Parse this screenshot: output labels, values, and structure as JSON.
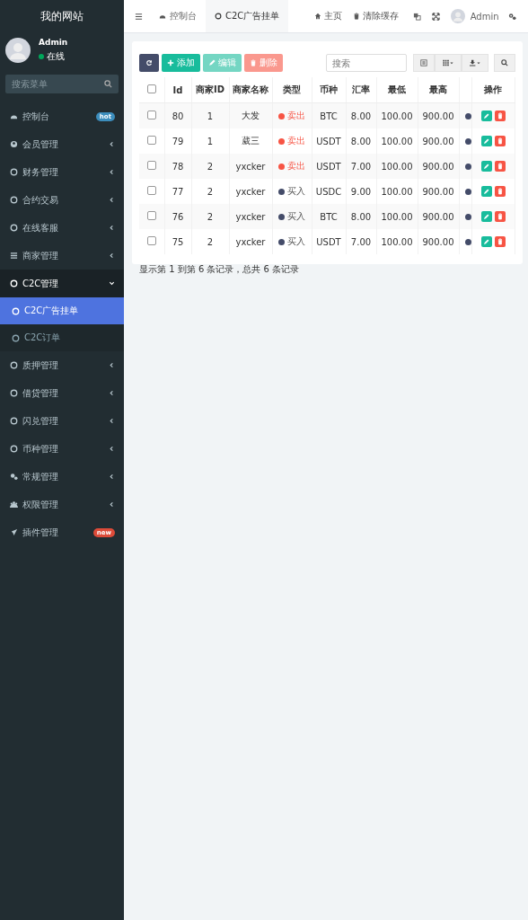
{
  "sidebar": {
    "site_title": "我的网站",
    "user": {
      "name": "Admin",
      "status": "在线"
    },
    "search": {
      "placeholder": "搜索菜单"
    },
    "items": [
      {
        "label": "控制台",
        "badge": {
          "text": "hot",
          "color": "#3c8dbc"
        },
        "expanded": false
      },
      {
        "label": "会员管理",
        "expanded": false
      },
      {
        "label": "财务管理",
        "expanded": false
      },
      {
        "label": "合约交易",
        "expanded": false
      },
      {
        "label": "在线客服",
        "expanded": false
      },
      {
        "label": "商家管理",
        "expanded": false
      },
      {
        "label": "C2C管理",
        "expanded": true,
        "children": [
          {
            "label": "C2C广告挂单",
            "selected": true
          },
          {
            "label": "C2C订单",
            "selected": false
          }
        ]
      },
      {
        "label": "质押管理",
        "expanded": false
      },
      {
        "label": "借贷管理",
        "expanded": false
      },
      {
        "label": "闪兑管理",
        "expanded": false
      },
      {
        "label": "币种管理",
        "expanded": false
      },
      {
        "label": "常规管理",
        "expanded": false
      },
      {
        "label": "权限管理",
        "expanded": false
      },
      {
        "label": "插件管理",
        "badge": {
          "text": "new",
          "color": "#dd4b39"
        },
        "expanded": false
      }
    ]
  },
  "topbar": {
    "tabs": [
      {
        "label": "控制台",
        "selected": false
      },
      {
        "label": "C2C广告挂单",
        "selected": true
      }
    ],
    "links": [
      "主页",
      "清除缓存"
    ],
    "user": "Admin"
  },
  "toolbar": {
    "buttons": [
      {
        "kind": "refresh",
        "disabled": false
      },
      {
        "kind": "add",
        "label": "添加",
        "disabled": false
      },
      {
        "kind": "edit",
        "label": "编辑",
        "disabled": true
      },
      {
        "kind": "delete",
        "label": "删除",
        "disabled": true
      }
    ],
    "search": {
      "placeholder": "搜索"
    }
  },
  "table": {
    "select_all_checked": false,
    "columns": [
      "Id",
      "商家ID",
      "商家名称",
      "类型",
      "币种",
      "汇率",
      "最低",
      "最高",
      "操作"
    ],
    "rows": [
      {
        "checked": false,
        "id": "80",
        "merchant_id": "1",
        "merchant_name": "大发",
        "type": {
          "label": "卖出",
          "color": "#f75444"
        },
        "coin": "BTC",
        "rate": "8.00",
        "min": "100.00",
        "max": "900.00"
      },
      {
        "checked": false,
        "id": "79",
        "merchant_id": "1",
        "merchant_name": "葳三",
        "type": {
          "label": "卖出",
          "color": "#f75444"
        },
        "coin": "USDT",
        "rate": "8.00",
        "min": "100.00",
        "max": "900.00"
      },
      {
        "checked": false,
        "id": "78",
        "merchant_id": "2",
        "merchant_name": "yxcker",
        "type": {
          "label": "卖出",
          "color": "#f75444"
        },
        "coin": "USDT",
        "rate": "7.00",
        "min": "100.00",
        "max": "900.00"
      },
      {
        "checked": false,
        "id": "77",
        "merchant_id": "2",
        "merchant_name": "yxcker",
        "type": {
          "label": "买入",
          "color": "#444c69"
        },
        "coin": "USDC",
        "rate": "9.00",
        "min": "100.00",
        "max": "900.00"
      },
      {
        "checked": false,
        "id": "76",
        "merchant_id": "2",
        "merchant_name": "yxcker",
        "type": {
          "label": "买入",
          "color": "#444c69"
        },
        "coin": "BTC",
        "rate": "8.00",
        "min": "100.00",
        "max": "900.00"
      },
      {
        "checked": false,
        "id": "75",
        "merchant_id": "2",
        "merchant_name": "yxcker",
        "type": {
          "label": "买入",
          "color": "#444c69"
        },
        "coin": "USDT",
        "rate": "7.00",
        "min": "100.00",
        "max": "900.00"
      }
    ],
    "footer": "显示第 1 到第 6 条记录，总共 6 条记录"
  }
}
